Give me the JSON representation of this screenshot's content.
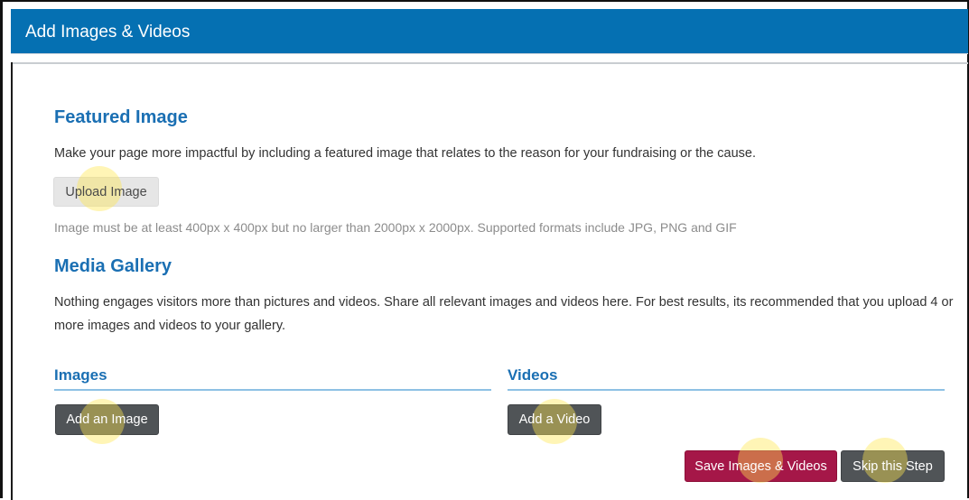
{
  "colors": {
    "header_bg": "#0570b2",
    "accent": "#1a6fb3",
    "button_dark": "#505457",
    "button_save": "#a51748",
    "click_marker": "#ffe850"
  },
  "window": {
    "title": "Add Images & Videos"
  },
  "featured": {
    "heading": "Featured Image",
    "description": "Make your page more impactful by including a featured image that relates to the reason for your fundraising or the cause.",
    "upload_label": "Upload Image",
    "hint": "Image must be at least 400px x 400px but no larger than 2000px x 2000px. Supported formats include JPG, PNG and GIF"
  },
  "gallery": {
    "heading": "Media Gallery",
    "description": "Nothing engages visitors more than pictures and videos. Share all relevant images and videos here. For best results, its recommended that you upload 4 or more images and videos to your gallery.",
    "images": {
      "heading": "Images",
      "add_label": "Add an Image"
    },
    "videos": {
      "heading": "Videos",
      "add_label": "Add a Video"
    }
  },
  "actions": {
    "save_label": "Save Images & Videos",
    "skip_label": "Skip this Step"
  }
}
